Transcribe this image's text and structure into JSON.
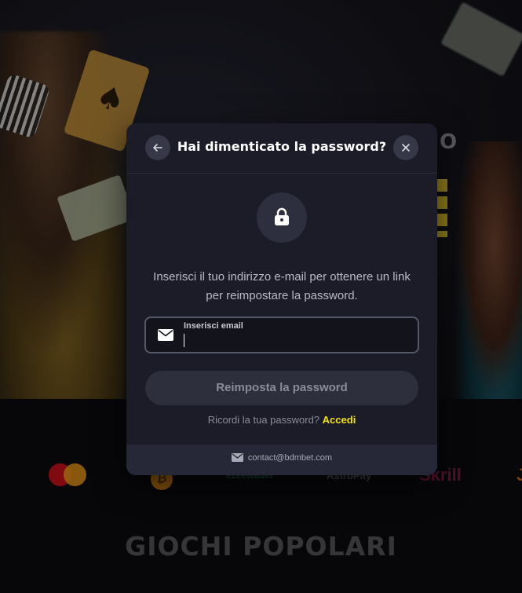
{
  "background": {
    "payments": {
      "ezeewallet": "ezeewallet",
      "astropay": "AstroPay",
      "skrill": "Skrill"
    },
    "section_title": "GIOCHI POPOLARI"
  },
  "modal": {
    "title": "Hai dimenticato la password?",
    "description": "Inserisci il tuo indirizzo e-mail per ottenere un link per reimpostare la password.",
    "email_field": {
      "label": "Inserisci email",
      "value": ""
    },
    "submit_label": "Reimposta la password",
    "remember_text": "Ricordi la tua password?",
    "login_link": "Accedi",
    "contact_email": "contact@bdmbet.com",
    "icons": {
      "back": "arrow-left-icon",
      "close": "close-icon",
      "lock": "lock-icon",
      "mail": "mail-icon"
    }
  },
  "colors": {
    "modal_bg": "#1b1c28",
    "accent_link": "#f2e21a",
    "button_bg": "#2d2f3d"
  }
}
